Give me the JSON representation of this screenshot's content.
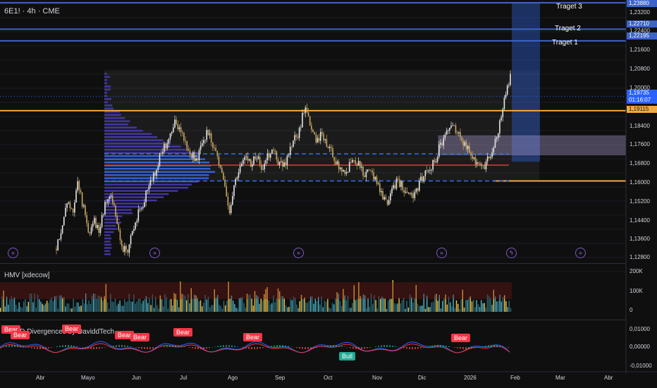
{
  "header": {
    "ticker": "6E1! · 4h · CME"
  },
  "indicators": {
    "hmv_label": "HMV [xdecow]",
    "macd_label": "MACD Divergences by DaviddTech"
  },
  "targets": [
    {
      "label": "Traget 3"
    },
    {
      "label": "Traget 2"
    },
    {
      "label": "Traget 1"
    }
  ],
  "price_axis": [
    "1,23200",
    "1,22400",
    "1,21600",
    "1,20800",
    "1,20000",
    "1,18400",
    "1,17600",
    "1,16800",
    "1,16000",
    "1,15200",
    "1,14400",
    "1,13600",
    "1,12800"
  ],
  "price_tags": {
    "t3": "1,23880",
    "t2": "1,22710",
    "t1": "1,22195",
    "current": "1,19735",
    "countdown": "01:16:07",
    "orange": "1,19115"
  },
  "volume_axis": [
    "200K",
    "100K",
    "0"
  ],
  "macd_axis": [
    "0,01000",
    "0,00000",
    "-0,01000"
  ],
  "time_axis": [
    "Abr",
    "Mayo",
    "Jun",
    "Jul",
    "Ago",
    "Sep",
    "Oct",
    "Nov",
    "Dic",
    "2026",
    "Feb",
    "Mar",
    "Abr"
  ],
  "signals": [
    "Bear",
    "Bear",
    "Bear",
    "Bear",
    "Bear",
    "Bear",
    "Bear",
    "Bear",
    "Bull"
  ],
  "colors": {
    "target_line": "#3d63c9",
    "orange_line": "#f5a83a",
    "red_line": "#e03a3a",
    "dashed_line": "#3570f0",
    "profile": "#4a3cb8",
    "candle_up": "#e8e8e8",
    "candle_down": "#c8a860"
  },
  "chart_data": {
    "type": "candlestick",
    "ylim": [
      1.124,
      1.24
    ],
    "close_path": [
      1.13,
      1.14,
      1.15,
      1.145,
      1.16,
      1.148,
      1.135,
      1.142,
      1.138,
      1.15,
      1.155,
      1.146,
      1.132,
      1.128,
      1.136,
      1.145,
      1.15,
      1.158,
      1.162,
      1.17,
      1.175,
      1.18,
      1.186,
      1.182,
      1.176,
      1.172,
      1.168,
      1.178,
      1.182,
      1.175,
      1.168,
      1.16,
      1.146,
      1.158,
      1.165,
      1.17,
      1.168,
      1.172,
      1.165,
      1.17,
      1.175,
      1.168,
      1.166,
      1.172,
      1.178,
      1.182,
      1.194,
      1.185,
      1.178,
      1.18,
      1.176,
      1.172,
      1.168,
      1.164,
      1.166,
      1.17,
      1.168,
      1.162,
      1.165,
      1.16,
      1.155,
      1.15,
      1.156,
      1.16,
      1.158,
      1.154,
      1.152,
      1.158,
      1.163,
      1.166,
      1.168,
      1.176,
      1.18,
      1.184,
      1.182,
      1.178,
      1.175,
      1.17,
      1.168,
      1.165,
      1.17,
      1.175,
      1.185,
      1.198,
      1.207
    ],
    "profile_center": 1.166,
    "levels": {
      "target3": 1.2388,
      "target2": 1.2271,
      "target1": 1.22195,
      "orange_top": 1.1911,
      "orange_bottom": 1.16,
      "red": 1.167,
      "dashed_upper": 1.172,
      "dashed_lower": 1.16
    },
    "volume_ylim": [
      0,
      200000
    ],
    "macd_ylim": [
      -0.01,
      0.01
    ]
  }
}
